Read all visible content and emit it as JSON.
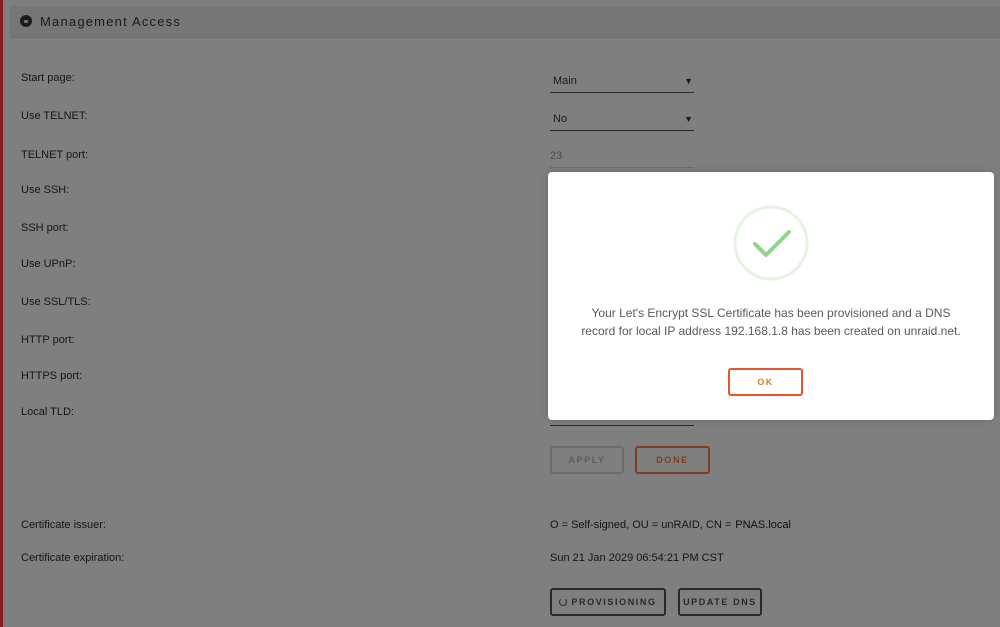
{
  "header": {
    "title": "Management Access",
    "icon": "lock-icon"
  },
  "settings": {
    "start_page": {
      "label": "Start page:",
      "value": "Main"
    },
    "use_telnet": {
      "label": "Use TELNET:",
      "value": "No"
    },
    "telnet_port": {
      "label": "TELNET port:",
      "value": "23"
    },
    "use_ssh": {
      "label": "Use SSH:"
    },
    "ssh_port": {
      "label": "SSH port:"
    },
    "use_upnp": {
      "label": "Use UPnP:"
    },
    "use_ssl": {
      "label": "Use SSL/TLS:"
    },
    "http_port": {
      "label": "HTTP port:"
    },
    "https_port": {
      "label": "HTTPS port:"
    },
    "local_tld": {
      "label": "Local TLD:"
    }
  },
  "buttons": {
    "apply": "APPLY",
    "done": "DONE",
    "provisioning": "PROVISIONING",
    "update_dns": "UPDATE DNS"
  },
  "certificate": {
    "issuer_label": "Certificate issuer:",
    "issuer_value": "O = Self-signed, OU = unRAID, CN =",
    "issuer_cn": "PNAS.local",
    "expiration_label": "Certificate expiration:",
    "expiration_value": "Sun 21 Jan 2029 06:54:21 PM CST"
  },
  "modal": {
    "icon": "checkmark-icon",
    "line1": "Your Let's Encrypt SSL Certificate has been provisioned and a DNS",
    "line2": "record for local IP address  192.168.1.8  has been created on unraid.net.",
    "ok_label": "OK"
  },
  "colors": {
    "overlay": "#7f7f7f",
    "accent": "#e8542a",
    "success": "#8fd68a"
  }
}
